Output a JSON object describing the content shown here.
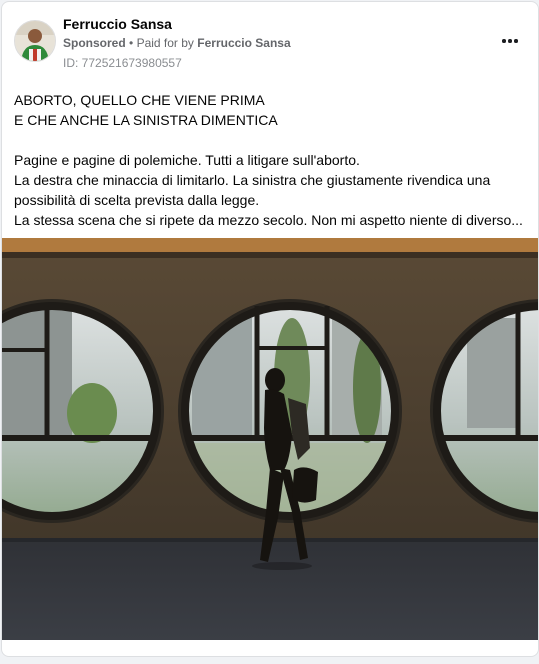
{
  "post": {
    "author": "Ferruccio Sansa",
    "sponsored_label": "Sponsored",
    "separator": "•",
    "paid_for_prefix": "Paid for by",
    "paid_for_name": "Ferruccio Sansa",
    "ad_id": "ID: 772521673980557",
    "more_icon": "more-horizontal-icon",
    "headline_lines": [
      "ABORTO, QUELLO CHE VIENE PRIMA",
      "E CHE ANCHE LA SINISTRA DIMENTICA"
    ],
    "body_lines": [
      "Pagine e pagine di polemiche. Tutti a litigare sull'aborto.",
      "La destra che minaccia di limitarlo. La sinistra che giustamente rivendica una",
      "possibilità di scelta prevista dalla legge.",
      "La stessa scena che si ripete da mezzo secolo. Non mi aspetto niente di diverso..."
    ]
  },
  "colors": {
    "text": "#050505",
    "secondary": "#65676b",
    "card_bg": "#ffffff",
    "page_bg": "#f0f2f5"
  }
}
